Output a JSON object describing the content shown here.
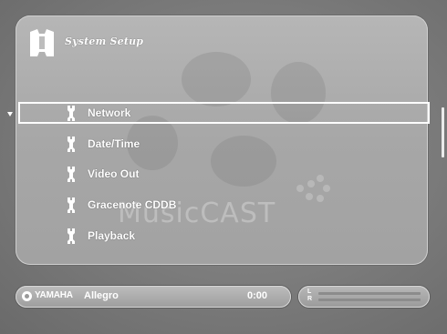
{
  "header": {
    "title": "System Setup",
    "icon": "system-setup-icon"
  },
  "watermark": {
    "text": "MusicCAST"
  },
  "menu": {
    "selected_index": 0,
    "items": [
      {
        "label": "Network",
        "icon": "wrench-icon"
      },
      {
        "label": "Date/Time",
        "icon": "wrench-icon"
      },
      {
        "label": "Video Out",
        "icon": "wrench-icon"
      },
      {
        "label": "Gracenote CDDB",
        "icon": "wrench-icon"
      },
      {
        "label": "Playback",
        "icon": "wrench-icon"
      }
    ]
  },
  "status": {
    "brand": "YAMAHA",
    "track": "Allegro",
    "time": "0:00"
  },
  "level_meter": {
    "left_label": "L",
    "right_label": "R",
    "left_level": 0,
    "right_level": 0
  },
  "colors": {
    "panel": "#a9a9a9",
    "text": "#ffffff",
    "background": "#7e7e7e"
  }
}
